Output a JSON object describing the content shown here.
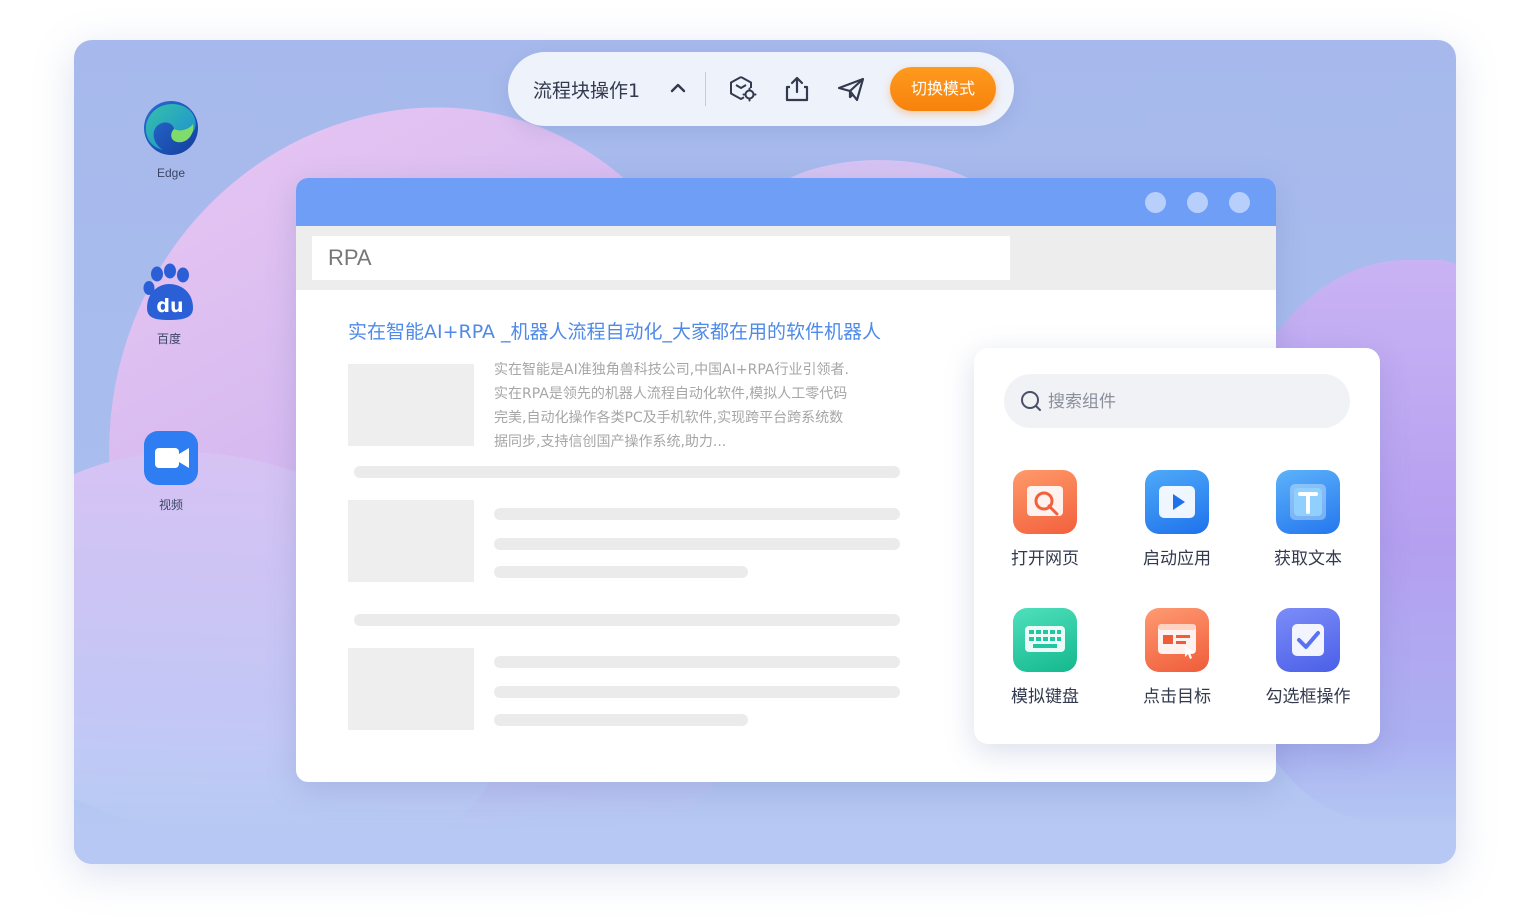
{
  "desktop": {
    "icons": [
      {
        "label": "Edge",
        "icon": "edge-browser-icon"
      },
      {
        "label": "百度",
        "icon": "baidu-paw-icon"
      },
      {
        "label": "视频",
        "icon": "video-camera-icon"
      }
    ]
  },
  "toolbar": {
    "title": "流程块操作1",
    "chevron_icon": "chevron-up-icon",
    "action_icons": [
      "hexagon-settings-icon",
      "share-export-icon",
      "send-paper-plane-icon"
    ],
    "switch_mode_label": "切换模式",
    "accent": "#f7820b"
  },
  "browser": {
    "address": "RPA",
    "titlebar_color": "#6f9ef7",
    "result": {
      "title": "实在智能AI+RPA _机器人流程自动化_大家都在用的软件机器人",
      "description_lines": [
        "实在智能是AI准独角兽科技公司,中国AI+RPA行业引领者.",
        "实在RPA是领先的机器人流程自动化软件,模拟人工零代码",
        "完美,自动化操作各类PC及手机软件,实现跨平台跨系统数",
        "据同步,支持信创国产操作系统,助力..."
      ]
    }
  },
  "panel": {
    "search_placeholder": "搜索组件",
    "components": [
      {
        "label": "打开网页",
        "icon": "open-webpage-icon",
        "color": "#f5734a"
      },
      {
        "label": "启动应用",
        "icon": "launch-app-icon",
        "color": "#2f8cf4"
      },
      {
        "label": "获取文本",
        "icon": "get-text-icon",
        "color": "#3b8ff5"
      },
      {
        "label": "模拟键盘",
        "icon": "keyboard-icon",
        "color": "#22c6a0"
      },
      {
        "label": "点击目标",
        "icon": "click-target-icon",
        "color": "#f4734e"
      },
      {
        "label": "勾选框操作",
        "icon": "checkbox-icon",
        "color": "#5a72f2"
      }
    ]
  }
}
